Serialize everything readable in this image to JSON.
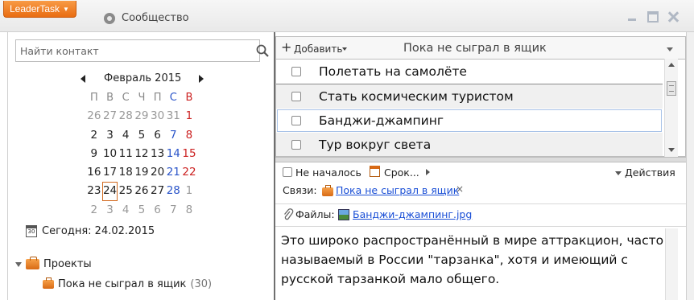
{
  "app": {
    "menu_label": "LeaderTask",
    "community_label": "Сообщество"
  },
  "sidebar": {
    "search_placeholder": "Найти контакт",
    "calendar": {
      "month_label": "Февраль 2015",
      "weekdays": [
        "П",
        "В",
        "С",
        "Ч",
        "П",
        "С",
        "В"
      ],
      "weeks": [
        [
          "26",
          "27",
          "28",
          "29",
          "30",
          "31",
          "1"
        ],
        [
          "2",
          "3",
          "4",
          "5",
          "6",
          "7",
          "8"
        ],
        [
          "9",
          "10",
          "11",
          "12",
          "13",
          "14",
          "15"
        ],
        [
          "16",
          "17",
          "18",
          "19",
          "20",
          "21",
          "22"
        ],
        [
          "23",
          "24",
          "25",
          "26",
          "27",
          "28",
          "1"
        ],
        [
          "2",
          "3",
          "4",
          "5",
          "6",
          "7",
          "8"
        ]
      ],
      "today_label": "Сегодня: 24.02.2015"
    },
    "projects_label": "Проекты",
    "projects": [
      {
        "name": "Пока не сыграл в ящик",
        "count": "(30)"
      }
    ]
  },
  "list": {
    "add_label": "Добавить",
    "title": "Пока не сыграл в ящик",
    "tasks": [
      {
        "title": "Полетать на самолёте"
      },
      {
        "title": "Стать космическим туристом"
      },
      {
        "title": "Банджи-джампинг"
      },
      {
        "title": "Тур вокруг света"
      }
    ]
  },
  "detail": {
    "status": "Не началось",
    "due": "Срок...",
    "actions": "Действия",
    "links_label": "Связи:",
    "link": "Пока не сыграл в ящик",
    "link_remove": "×",
    "files_label": "Файлы:",
    "file": "Банджи-джампинг.jpg",
    "notes": "Это широко распространённый в мире аттракцион, часто называемый в России \"тарзанка\", хотя и имеющий с русской тарзанкой мало общего."
  }
}
